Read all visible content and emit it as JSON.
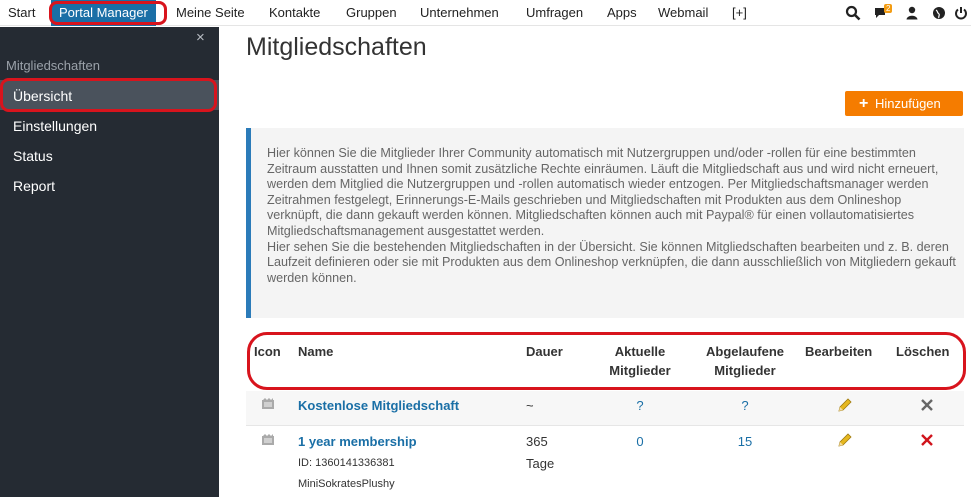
{
  "nav": {
    "items": [
      "Start",
      "Portal Manager",
      "Meine Seite",
      "Kontakte",
      "Gruppen",
      "Unternehmen",
      "Umfragen",
      "Apps",
      "Webmail",
      "[+]"
    ],
    "notification_count": "2"
  },
  "sidebar": {
    "close": "×",
    "heading": "Mitgliedschaften",
    "items": [
      "Übersicht",
      "Einstellungen",
      "Status",
      "Report"
    ]
  },
  "main": {
    "title": "Mitgliedschaften",
    "add_button": "Hinzufügen",
    "info_text": "Hier können Sie die Mitglieder Ihrer Community automatisch mit Nutzergruppen und/oder -rollen für eine bestimmten Zeitraum ausstatten und Ihnen somit zusätzliche Rechte einräumen. Läuft die Mitgliedschaft aus und wird nicht erneuert, werden dem Mitglied die Nutzergruppen und -rollen automatisch wieder entzogen. Per Mitgliedschaftsmanager werden Zeitrahmen festgelegt, Erinnerungs-E-Mails geschrieben und Mitgliedschaften mit Produkten aus dem Onlineshop verknüpft, die dann gekauft werden können. Mitgliedschaften können auch mit Paypal® für einen vollautomatisiertes Mitgliedschaftsmanagement ausgestattet werden.",
    "info_text2": "Hier sehen Sie die bestehenden Mitgliedschaften in der Übersicht. Sie können Mitgliedschaften bearbeiten und z. B. deren Laufzeit definieren oder sie mit Produkten aus dem Onlineshop verknüpfen, die dann ausschließlich von Mitgliedern gekauft werden können."
  },
  "table": {
    "headers": {
      "icon": "Icon",
      "name": "Name",
      "dauer": "Dauer",
      "aktuelle_1": "Aktuelle",
      "aktuelle_2": "Mitglieder",
      "abgelaufene_1": "Abgelaufene",
      "abgelaufene_2": "Mitglieder",
      "bearbeiten": "Bearbeiten",
      "loeschen": "Löschen"
    },
    "rows": [
      {
        "name": "Kostenlose Mitgliedschaft",
        "dauer": "~",
        "aktuelle": "?",
        "abgelaufene": "?"
      },
      {
        "name": "1 year membership",
        "id": "ID: 1360141336381",
        "product": "MiniSokratesPlushy",
        "dauer_1": "365",
        "dauer_2": "Tage",
        "aktuelle": "0",
        "abgelaufene": "15"
      }
    ]
  },
  "colors": {
    "accent": "#1a6fa6",
    "highlight": "#d8141d",
    "button": "#f57c00",
    "sidebar": "#252b33"
  }
}
